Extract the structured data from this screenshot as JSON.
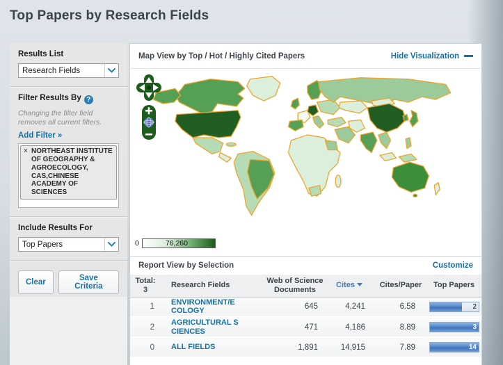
{
  "page": {
    "title": "Top Papers by Research Fields"
  },
  "sidebar": {
    "results_list": {
      "label": "Results List",
      "selected": "Research Fields"
    },
    "filter": {
      "label": "Filter Results By",
      "help_icon": "?",
      "note": "Changing the filter field removes all current filters.",
      "add_filter": "Add Filter »",
      "tag": {
        "remove": "×",
        "label": "NORTHEAST INSTITUTE OF GEOGRAPHY & AGROECOLOGY, CAS,CHINESE ACADEMY OF SCIENCES"
      }
    },
    "include": {
      "label": "Include Results For",
      "selected": "Top Papers"
    },
    "buttons": {
      "clear": "Clear",
      "save": "Save Criteria"
    }
  },
  "map": {
    "header": "Map View by Top / Hot / Highly Cited Papers",
    "hide_link": "Hide Visualization",
    "controls": [
      "pan",
      "zoom-in",
      "globe-reset",
      "zoom-out"
    ],
    "legend": {
      "min": "0",
      "max": "76,260"
    },
    "shading_highest": [
      "United States",
      "China"
    ],
    "shading_high": [
      "Canada",
      "Brazil",
      "Australia",
      "India",
      "Germany",
      "Spain",
      "United Kingdom",
      "Scandinavia",
      "Japan"
    ],
    "shading_medium": [
      "Russia",
      "Saudi Arabia",
      "Mexico",
      "Argentina",
      "Eastern Europe",
      "Southeast Asia"
    ],
    "shading_low": [
      "Africa (most)",
      "Greenland",
      "Central Asia"
    ]
  },
  "report": {
    "header": "Report View by Selection",
    "customize": "Customize",
    "table": {
      "total_label": "Total:",
      "total_value": "3",
      "columns": {
        "field": "Research Fields",
        "docs_line1": "Web of Science",
        "docs_line2": "Documents",
        "cites": "Cites",
        "cites_per_paper": "Cites/Paper",
        "top_papers": "Top Papers"
      },
      "rows": [
        {
          "num": "1",
          "field": "ENVIRONMENT/ECOLOGY",
          "docs": "645",
          "cites": "4,241",
          "cites_per_paper": "6.58",
          "top_papers": "2",
          "bar_pct": 66
        },
        {
          "num": "2",
          "field": "AGRICULTURAL SCIENCES",
          "docs": "471",
          "cites": "4,186",
          "cites_per_paper": "8.89",
          "top_papers": "3",
          "bar_pct": 100
        },
        {
          "num": "0",
          "field": "ALL FIELDS",
          "docs": "1,891",
          "cites": "14,915",
          "cites_per_paper": "7.89",
          "top_papers": "14",
          "bar_pct": 100
        }
      ]
    }
  },
  "colors": {
    "link_blue": "#1470a8",
    "header_text": "#3d434b",
    "map_orange": "#efa32a",
    "bar_blue": "#4a7fc1",
    "choropleth_max": "#215e23",
    "sidebar_bg": "#e6e6e6"
  }
}
